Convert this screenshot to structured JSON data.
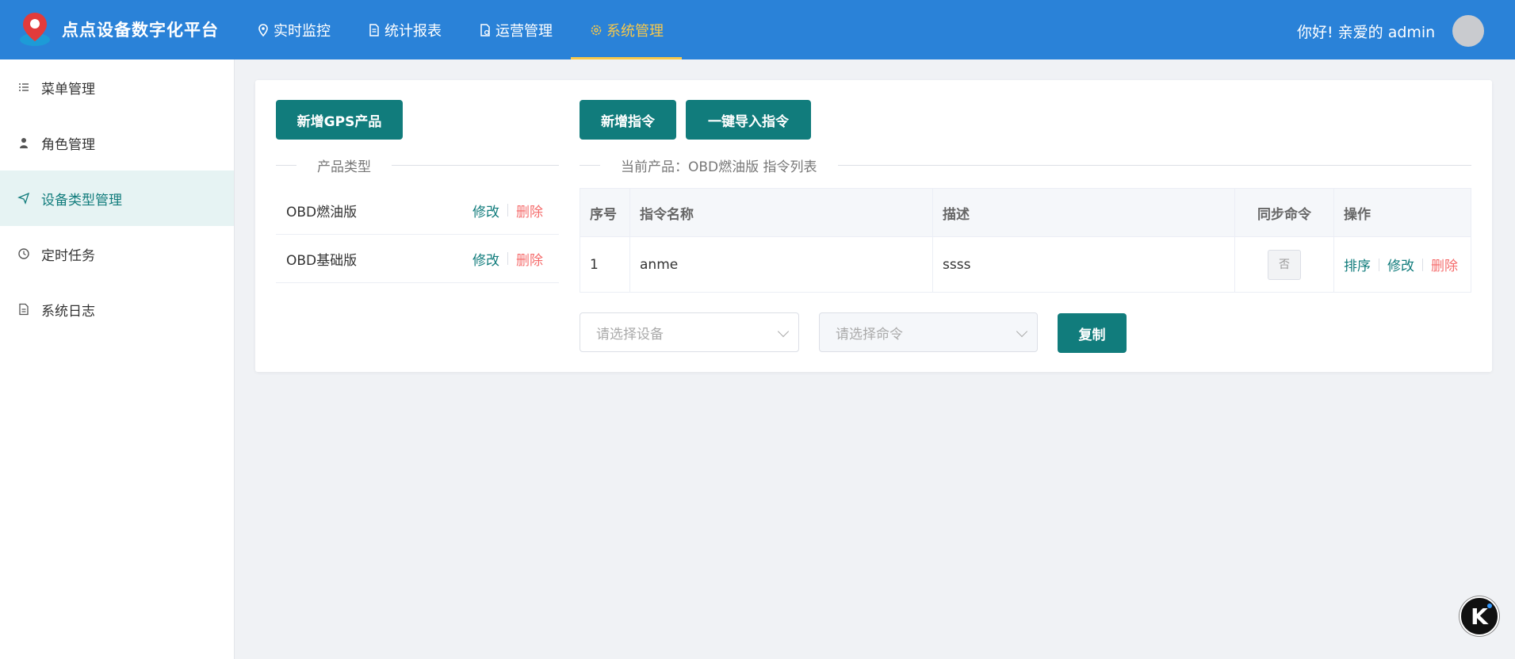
{
  "header": {
    "title": "点点设备数字化平台",
    "nav": [
      {
        "label": "实时监控",
        "icon": "location-pin-icon"
      },
      {
        "label": "统计报表",
        "icon": "document-icon"
      },
      {
        "label": "运营管理",
        "icon": "document-settings-icon"
      },
      {
        "label": "系统管理",
        "icon": "gear-icon",
        "active": true
      }
    ],
    "greeting": "你好! 亲爱的 admin"
  },
  "sidebar": {
    "items": [
      {
        "label": "菜单管理",
        "icon": "list-icon"
      },
      {
        "label": "角色管理",
        "icon": "user-icon"
      },
      {
        "label": "设备类型管理",
        "icon": "send-icon",
        "active": true
      },
      {
        "label": "定时任务",
        "icon": "clock-icon"
      },
      {
        "label": "系统日志",
        "icon": "log-icon"
      }
    ]
  },
  "main": {
    "add_gps_button": "新增GPS产品",
    "add_command_button": "新增指令",
    "import_commands_button": "一键导入指令",
    "product_section_title": "产品类型",
    "command_section_title": "当前产品：OBD燃油版 指令列表",
    "products": [
      {
        "name": "OBD燃油版",
        "edit": "修改",
        "delete": "删除"
      },
      {
        "name": "OBD基础版",
        "edit": "修改",
        "delete": "删除"
      }
    ],
    "table": {
      "headers": [
        "序号",
        "指令名称",
        "描述",
        "同步命令",
        "操作"
      ],
      "rows": [
        {
          "index": "1",
          "name": "anme",
          "description": "ssss",
          "sync": "否",
          "sort": "排序",
          "edit": "修改",
          "delete": "删除"
        }
      ]
    },
    "device_select_placeholder": "请选择设备",
    "command_select_placeholder": "请选择命令",
    "copy_button": "复制"
  },
  "colors": {
    "header_bg": "#2a82d8",
    "accent": "#117c7c",
    "active_nav": "#f7c84b",
    "danger": "#f56c6c"
  },
  "floating_badge": "K"
}
